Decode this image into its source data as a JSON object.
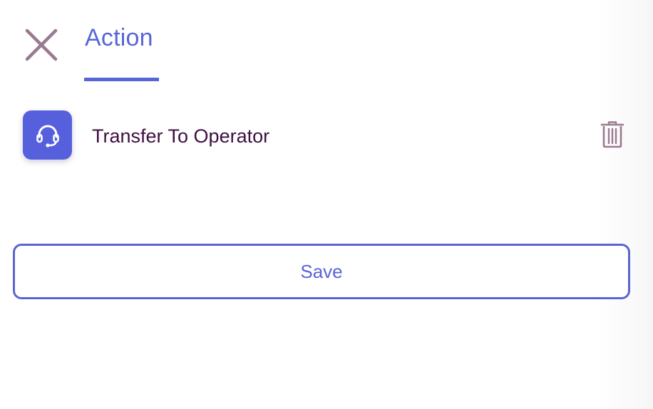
{
  "header": {
    "close_icon": "close-icon",
    "tab_label": "Action"
  },
  "action": {
    "icon": "headset-icon",
    "label": "Transfer To Operator",
    "delete_icon": "trash-icon"
  },
  "footer": {
    "save_label": "Save"
  },
  "colors": {
    "accent": "#5865d6",
    "close_icon": "#9a7a90",
    "trash_icon": "#9a7a90",
    "action_label": "#3d0f40",
    "action_icon_bg": "#5660dd"
  }
}
